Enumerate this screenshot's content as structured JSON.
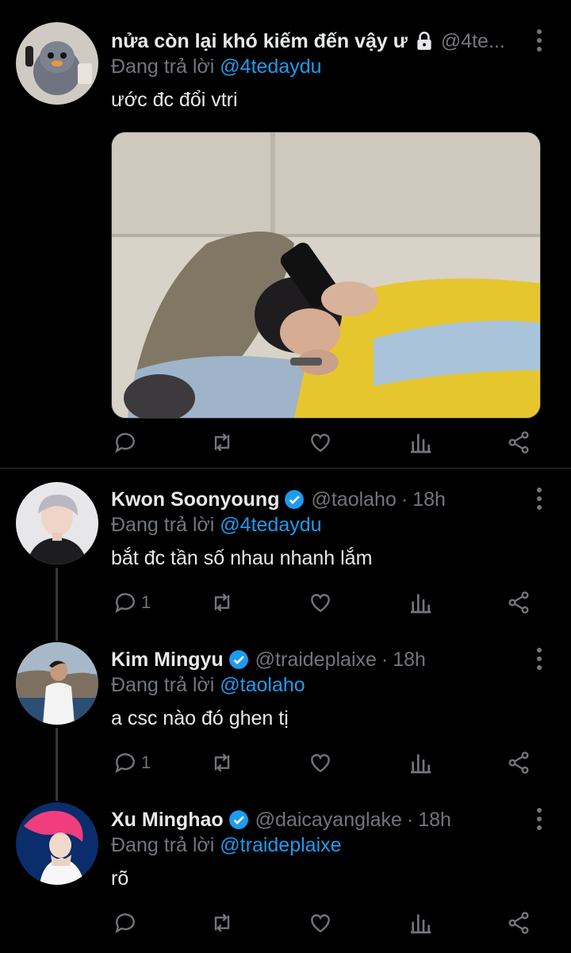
{
  "tweets": [
    {
      "name": "nửa còn lại khó kiếm đến vậy ư",
      "handle": "@4te...",
      "time": "",
      "reply_prefix": "Đang trả lời",
      "reply_to": "@4tedaydu",
      "text": "ước đc đổi vtri",
      "replies": "",
      "protected": true
    },
    {
      "name": "Kwon Soonyoung",
      "handle": "@taolaho",
      "time": "18h",
      "reply_prefix": "Đang trả lời",
      "reply_to": "@4tedaydu",
      "text": "bắt đc tần số nhau nhanh lắm",
      "replies": "1",
      "verified": true
    },
    {
      "name": "Kim Mingyu",
      "handle": "@traideplaixe",
      "time": "18h",
      "reply_prefix": "Đang trả lời",
      "reply_to": "@taolaho",
      "text": "a csc nào đó ghen tị",
      "replies": "1",
      "verified": true
    },
    {
      "name": "Xu Minghao",
      "handle": "@daicayanglake",
      "time": "18h",
      "reply_prefix": "Đang trả lời",
      "reply_to": "@traideplaixe",
      "text": "rõ",
      "replies": "",
      "verified": true
    }
  ],
  "separator": "·",
  "colors": {
    "background": "#000000",
    "text": "#e7e9ea",
    "muted": "#71767b",
    "accent": "#1d9bf0"
  },
  "icons": [
    "reply-icon",
    "retweet-icon",
    "like-icon",
    "analytics-icon",
    "share-icon",
    "more-icon",
    "verified-icon",
    "lock-icon"
  ]
}
